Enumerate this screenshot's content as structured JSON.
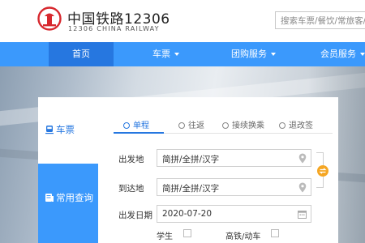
{
  "header": {
    "title": "中国铁路12306",
    "subtitle": "12306 CHINA RAILWAY",
    "search_placeholder": "搜索车票/餐饮/常旅客/相"
  },
  "nav": {
    "items": [
      {
        "label": "首页",
        "active": true
      },
      {
        "label": "车票",
        "dropdown": true
      },
      {
        "label": "团购服务",
        "dropdown": true
      },
      {
        "label": "会员服务",
        "dropdown": true
      }
    ]
  },
  "sidebar": {
    "tabs": [
      {
        "label": "车票",
        "icon": "train-icon",
        "active": true
      },
      {
        "label": "常用查询",
        "icon": "query-icon",
        "active": false
      }
    ]
  },
  "booking": {
    "trip_types": [
      {
        "label": "单程",
        "active": true
      },
      {
        "label": "往返",
        "active": false
      },
      {
        "label": "接续换乘",
        "active": false
      },
      {
        "label": "退改签",
        "active": false
      }
    ],
    "from": {
      "label": "出发地",
      "placeholder": "简拼/全拼/汉字"
    },
    "to": {
      "label": "到达地",
      "placeholder": "简拼/全拼/汉字"
    },
    "date": {
      "label": "出发日期",
      "value": "2020-07-20"
    },
    "options": [
      {
        "label": "学生",
        "checked": false
      },
      {
        "label": "高铁/动车",
        "checked": false
      }
    ]
  },
  "colors": {
    "brand_blue": "#3b99fc",
    "active_blue": "#2677e0",
    "logo_red": "#d7282e",
    "swap_orange": "#f5a623"
  }
}
